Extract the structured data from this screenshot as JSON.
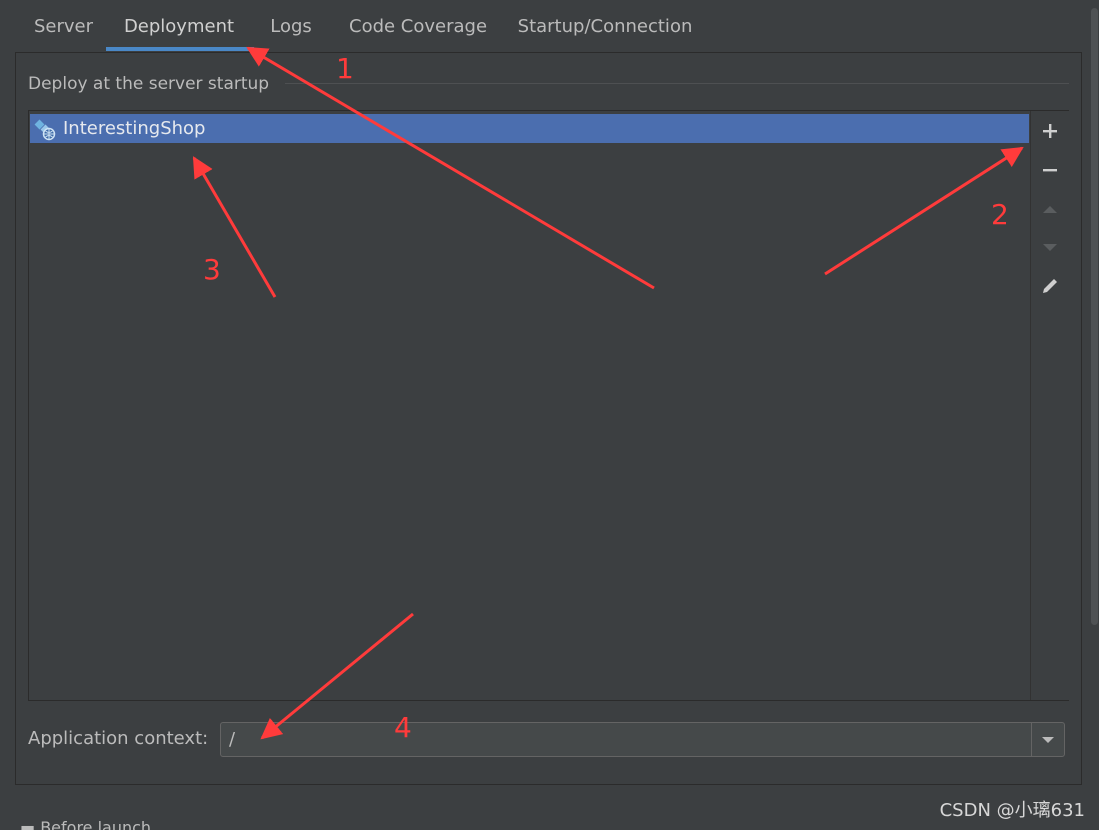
{
  "tabs": [
    {
      "label": "Server",
      "active": false
    },
    {
      "label": "Deployment",
      "active": true
    },
    {
      "label": "Logs",
      "active": false
    },
    {
      "label": "Code Coverage",
      "active": false
    },
    {
      "label": "Startup/Connection",
      "active": false
    }
  ],
  "deploy_section": {
    "title": "Deploy at the server startup",
    "items": [
      {
        "label": "InterestingShop",
        "icon": "artifact-icon",
        "selected": true
      }
    ],
    "toolbar": {
      "add_icon": "plus-icon",
      "remove_icon": "minus-icon",
      "up_icon": "arrow-up-icon",
      "down_icon": "arrow-down-icon",
      "edit_icon": "pencil-icon"
    }
  },
  "application_context": {
    "label": "Application context:",
    "value": "/"
  },
  "before_launch": {
    "label": "Before launch"
  },
  "watermark": "CSDN @小璃631",
  "annotations": [
    "1",
    "2",
    "3",
    "4"
  ],
  "colors": {
    "background": "#3c3f41",
    "selection": "#4b6eaf",
    "tab_underline": "#4a88c7",
    "annotation": "#ff3b3b"
  }
}
